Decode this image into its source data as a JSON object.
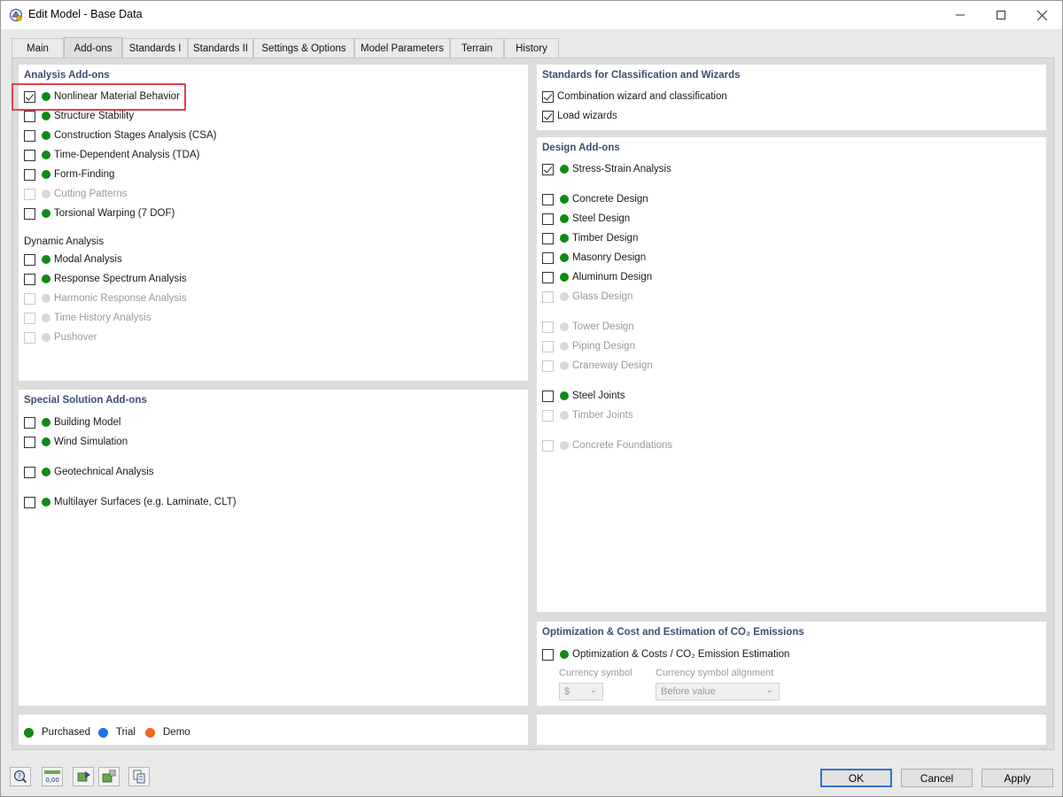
{
  "window": {
    "title": "Edit Model - Base Data",
    "icons": {
      "app": "rfem-model-icon",
      "minimize": "minimize-icon",
      "maximize": "maximize-icon",
      "close": "close-icon"
    }
  },
  "tabs": [
    {
      "label": "Main",
      "active": false
    },
    {
      "label": "Add-ons",
      "active": true
    },
    {
      "label": "Standards I",
      "active": false
    },
    {
      "label": "Standards II",
      "active": false
    },
    {
      "label": "Settings & Options",
      "active": false
    },
    {
      "label": "Model Parameters",
      "active": false
    },
    {
      "label": "Terrain",
      "active": false
    },
    {
      "label": "History",
      "active": false
    }
  ],
  "analysis": {
    "title": "Analysis Add-ons",
    "items": [
      {
        "label": "Nonlinear Material Behavior",
        "checked": true,
        "enabled": true
      },
      {
        "label": "Structure Stability",
        "checked": false,
        "enabled": true
      },
      {
        "label": "Construction Stages Analysis (CSA)",
        "checked": false,
        "enabled": true
      },
      {
        "label": "Time-Dependent Analysis (TDA)",
        "checked": false,
        "enabled": true
      },
      {
        "label": "Form-Finding",
        "checked": false,
        "enabled": true
      },
      {
        "label": "Cutting Patterns",
        "checked": false,
        "enabled": false
      },
      {
        "label": "Torsional Warping (7 DOF)",
        "checked": false,
        "enabled": true
      }
    ],
    "dynamic_title": "Dynamic Analysis",
    "dynamic_items": [
      {
        "label": "Modal Analysis",
        "checked": false,
        "enabled": true
      },
      {
        "label": "Response Spectrum Analysis",
        "checked": false,
        "enabled": true
      },
      {
        "label": "Harmonic Response Analysis",
        "checked": false,
        "enabled": false
      },
      {
        "label": "Time History Analysis",
        "checked": false,
        "enabled": false
      },
      {
        "label": "Pushover",
        "checked": false,
        "enabled": false
      }
    ]
  },
  "special": {
    "title": "Special Solution Add-ons",
    "items": [
      {
        "label": "Building Model",
        "checked": false,
        "enabled": true
      },
      {
        "label": "Wind Simulation",
        "checked": false,
        "enabled": true
      },
      {
        "label": "Geotechnical Analysis",
        "checked": false,
        "enabled": true
      },
      {
        "label": "Multilayer Surfaces (e.g. Laminate, CLT)",
        "checked": false,
        "enabled": true
      }
    ]
  },
  "standards": {
    "title": "Standards for Classification and Wizards",
    "items": [
      {
        "label": "Combination wizard and classification",
        "checked": true
      },
      {
        "label": "Load wizards",
        "checked": true
      }
    ]
  },
  "design": {
    "title": "Design Add-ons",
    "items": [
      {
        "label": "Stress-Strain Analysis",
        "checked": true,
        "enabled": true
      },
      {
        "label": "Concrete Design",
        "checked": false,
        "enabled": true
      },
      {
        "label": "Steel Design",
        "checked": false,
        "enabled": true
      },
      {
        "label": "Timber Design",
        "checked": false,
        "enabled": true
      },
      {
        "label": "Masonry Design",
        "checked": false,
        "enabled": true
      },
      {
        "label": "Aluminum Design",
        "checked": false,
        "enabled": true
      },
      {
        "label": "Glass Design",
        "checked": false,
        "enabled": false
      },
      {
        "label": "Tower Design",
        "checked": false,
        "enabled": false
      },
      {
        "label": "Piping Design",
        "checked": false,
        "enabled": false
      },
      {
        "label": "Craneway Design",
        "checked": false,
        "enabled": false
      },
      {
        "label": "Steel Joints",
        "checked": false,
        "enabled": true
      },
      {
        "label": "Timber Joints",
        "checked": false,
        "enabled": false
      },
      {
        "label": "Concrete Foundations",
        "checked": false,
        "enabled": false
      }
    ]
  },
  "optimization": {
    "title": "Optimization & Cost and Estimation of CO₂ Emissions",
    "item": {
      "label": "Optimization & Costs / CO₂ Emission Estimation",
      "checked": false,
      "enabled": true
    },
    "currency_symbol_label": "Currency symbol",
    "currency_symbol_value": "$",
    "alignment_label": "Currency symbol alignment",
    "alignment_value": "Before value"
  },
  "legend": [
    {
      "label": "Purchased",
      "color": "#0e8a16"
    },
    {
      "label": "Trial",
      "color": "#1a73e8"
    },
    {
      "label": "Demo",
      "color": "#f26522"
    }
  ],
  "toolbar_icons": [
    "help-icon",
    "units-icon",
    "model-import-icon",
    "model-settings-icon",
    "copy-report-icon"
  ],
  "units_icon_text": "0,00",
  "buttons": {
    "ok": "OK",
    "cancel": "Cancel",
    "apply": "Apply"
  }
}
